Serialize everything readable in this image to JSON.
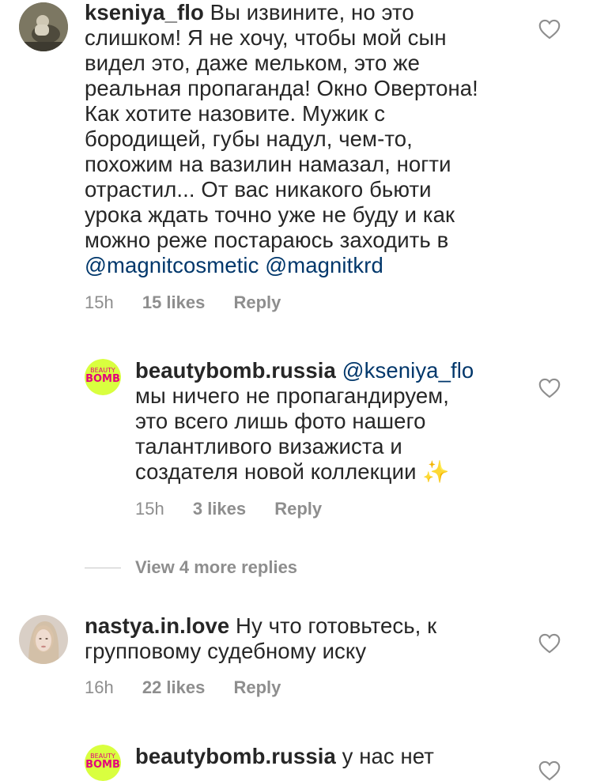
{
  "comments": [
    {
      "username": "kseniya_flo",
      "body_lines": [
        "Вы извините, но это",
        "слишком! Я не хочу, чтобы мой сын",
        "видел это, даже мельком, это же",
        "реальная пропаганда! Окно Овертона!",
        "Как хотите назовите. Мужик с",
        "бородищей, губы надул, чем-то,",
        "похожим на вазилин намазал, ногти",
        "отрастил... От вас никакого бьюти",
        "урока ждать точно уже не буду и как",
        "можно реже постараюсь заходить в"
      ],
      "mentions": "@magnitcosmetic @magnitkrd",
      "time": "15h",
      "likes": "15 likes",
      "reply": "Reply"
    },
    {
      "username": "beautybomb.russia",
      "mention": "@kseniya_flo",
      "body_lines": [
        "мы ничего не пропагандируем,",
        "это всего лишь фото нашего",
        "талантливого визажиста и",
        "создателя новой коллекции ✨"
      ],
      "time": "15h",
      "likes": "3 likes",
      "reply": "Reply",
      "avatar_text_top": "BEAUTY",
      "avatar_text_bottom": "BOMB"
    },
    {
      "username": "nastya.in.love",
      "body_lines": [
        "Ну что готовьтесь, к",
        "групповому судебному иску"
      ],
      "time": "16h",
      "likes": "22 likes",
      "reply": "Reply"
    },
    {
      "username": "beautybomb.russia",
      "body_lines": [
        "у нас нет"
      ],
      "avatar_text_top": "BEAUTY",
      "avatar_text_bottom": "BOMB"
    }
  ],
  "view_more": "View 4 more replies",
  "colors": {
    "text": "#262626",
    "meta": "#8e8e8e",
    "mention": "#00376b",
    "brand_bg": "#d9ff3f",
    "brand_fg": "#e4007c"
  }
}
